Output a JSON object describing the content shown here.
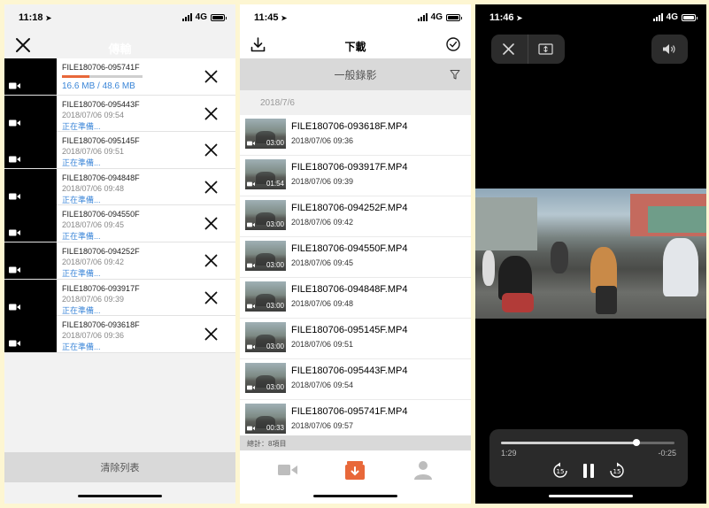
{
  "accent": "#e8683a",
  "link_color": "#3b86d8",
  "panel1": {
    "status_time": "11:18",
    "network": "4G",
    "title": "傳輸",
    "rows": [
      {
        "name": "FILE180706-095741F",
        "date": "",
        "status": "",
        "progress": 0.34,
        "size": "16.6 MB / 48.6 MB"
      },
      {
        "name": "FILE180706-095443F",
        "date": "2018/07/06 09:54",
        "status": "正在準備..."
      },
      {
        "name": "FILE180706-095145F",
        "date": "2018/07/06 09:51",
        "status": "正在準備..."
      },
      {
        "name": "FILE180706-094848F",
        "date": "2018/07/06 09:48",
        "status": "正在準備..."
      },
      {
        "name": "FILE180706-094550F",
        "date": "2018/07/06 09:45",
        "status": "正在準備..."
      },
      {
        "name": "FILE180706-094252F",
        "date": "2018/07/06 09:42",
        "status": "正在準備..."
      },
      {
        "name": "FILE180706-093917F",
        "date": "2018/07/06 09:39",
        "status": "正在準備..."
      },
      {
        "name": "FILE180706-093618F",
        "date": "2018/07/06 09:36",
        "status": "正在準備..."
      }
    ],
    "clear_label": "清除列表",
    "icons": {
      "close": "close-icon",
      "remove": "close-icon",
      "thumb": "video-camera-icon"
    }
  },
  "panel2": {
    "status_time": "11:45",
    "network": "4G",
    "title": "下載",
    "category": "一般錄影",
    "date_header": "2018/7/6",
    "videos": [
      {
        "name": "FILE180706-093618F.MP4",
        "date": "2018/07/06 09:36",
        "duration": "03:00"
      },
      {
        "name": "FILE180706-093917F.MP4",
        "date": "2018/07/06 09:39",
        "duration": "01:54"
      },
      {
        "name": "FILE180706-094252F.MP4",
        "date": "2018/07/06 09:42",
        "duration": "03:00"
      },
      {
        "name": "FILE180706-094550F.MP4",
        "date": "2018/07/06 09:45",
        "duration": "03:00"
      },
      {
        "name": "FILE180706-094848F.MP4",
        "date": "2018/07/06 09:48",
        "duration": "03:00"
      },
      {
        "name": "FILE180706-095145F.MP4",
        "date": "2018/07/06 09:51",
        "duration": "03:00"
      },
      {
        "name": "FILE180706-095443F.MP4",
        "date": "2018/07/06 09:54",
        "duration": "03:00"
      },
      {
        "name": "FILE180706-095741F.MP4",
        "date": "2018/07/06 09:57",
        "duration": "00:33"
      }
    ],
    "total": "總計：8項目",
    "tabs": [
      "video-camera-icon",
      "download-box-icon",
      "person-icon"
    ],
    "active_tab": 1
  },
  "panel3": {
    "status_time": "11:46",
    "network": "4G",
    "elapsed": "1:29",
    "remaining": "-0:25",
    "progress": 0.78,
    "skip_back": "15",
    "skip_fwd": "15"
  }
}
